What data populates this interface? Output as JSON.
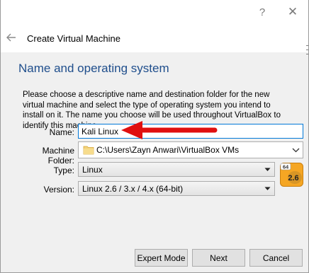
{
  "window": {
    "help_glyph": "?",
    "close_glyph": "✕"
  },
  "header": {
    "title": "Create Virtual Machine",
    "back_icon": "back-arrow-icon"
  },
  "section": {
    "title": "Name and operating system",
    "description": "Please choose a descriptive name and destination folder for the new virtual machine and select the type of operating system you intend to install on it. The name you choose will be used throughout VirtualBox to identify this machine."
  },
  "form": {
    "name_label": "Name:",
    "name_value": "Kali Linux",
    "folder_label": "Machine Folder:",
    "folder_value": "C:\\Users\\Zayn Anwari\\VirtualBox VMs",
    "type_label": "Type:",
    "type_value": "Linux",
    "version_label": "Version:",
    "version_value": "Linux 2.6 / 3.x / 4.x (64-bit)"
  },
  "os_badge": {
    "bits": "64",
    "version": "2.6"
  },
  "buttons": {
    "expert": "Expert Mode",
    "next": "Next",
    "cancel": "Cancel"
  },
  "colors": {
    "section_title": "#1f4e8c",
    "focus_border": "#0078d7",
    "annotation_arrow": "#e01010"
  }
}
